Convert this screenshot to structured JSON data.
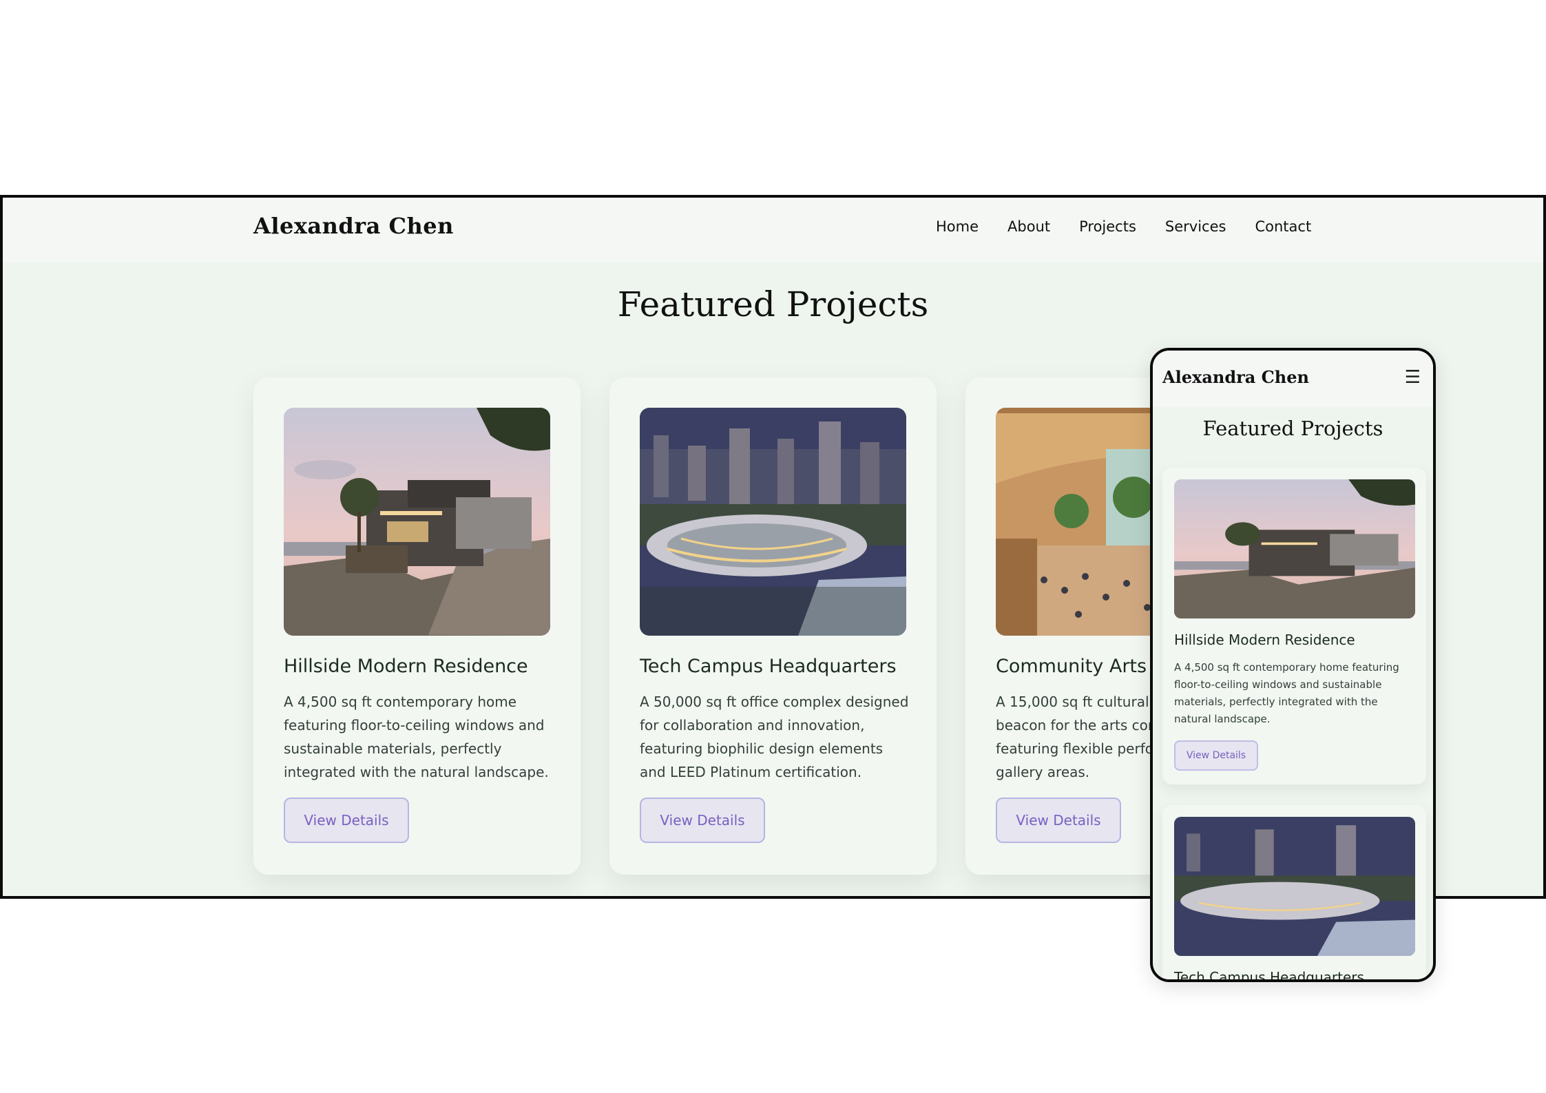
{
  "site": {
    "logo": "Alexandra Chen",
    "nav": [
      "Home",
      "About",
      "Projects",
      "Services",
      "Contact"
    ],
    "menu_icon": "☰"
  },
  "section_title": "Featured Projects",
  "projects": [
    {
      "title": "Hillside Modern Residence",
      "description": "A 4,500 sq ft contemporary home featuring floor-to-ceiling windows and sustainable materials, perfectly integrated with the natural landscape.",
      "button": "View Details",
      "image": "hillside-residence-photo"
    },
    {
      "title": "Tech Campus Headquarters",
      "description": "A 50,000 sq ft office complex designed for collaboration and innovation, featuring biophilic design elements and LEED Platinum certification.",
      "button": "View Details",
      "image": "tech-campus-photo"
    },
    {
      "title": "Community Arts Center",
      "description": "A 15,000 sq ft cultural hub serving as a beacon for the arts community, featuring flexible performance and gallery areas.",
      "button": "View Details",
      "image": "arts-center-photo"
    }
  ],
  "colors": {
    "accent": "#7a5fc1",
    "page_bg": "#eef5ee",
    "card_bg": "#f2f7f2",
    "header_bg": "#f4f7f4"
  }
}
